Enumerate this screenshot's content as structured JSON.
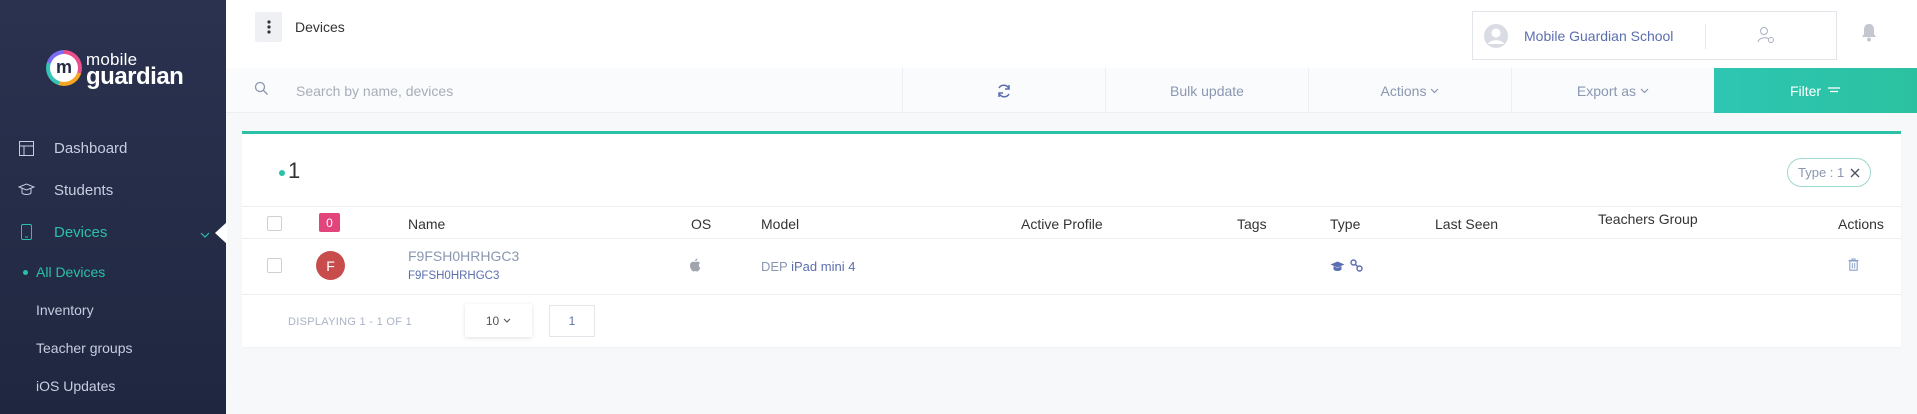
{
  "brand": {
    "line1": "mobile",
    "line2": "guardian"
  },
  "sidebar": {
    "items": [
      {
        "label": "Dashboard",
        "icon": "dashboard-icon"
      },
      {
        "label": "Students",
        "icon": "graduation-cap-icon"
      },
      {
        "label": "Devices",
        "icon": "phone-icon",
        "active": true
      }
    ],
    "subitems": [
      {
        "label": "All Devices",
        "active": true
      },
      {
        "label": "Inventory"
      },
      {
        "label": "Teacher groups"
      },
      {
        "label": "iOS Updates"
      }
    ]
  },
  "header": {
    "title": "Devices",
    "account_name": "Mobile Guardian School"
  },
  "toolbar": {
    "search_placeholder": "Search by name, devices",
    "bulk_update": "Bulk update",
    "actions": "Actions",
    "export": "Export as",
    "filter": "Filter"
  },
  "results": {
    "count": "1",
    "filter_chip": "Type : 1",
    "selected_badge": "0"
  },
  "table": {
    "columns": {
      "name": "Name",
      "os": "OS",
      "model": "Model",
      "active_profile": "Active Profile",
      "tags": "Tags",
      "type": "Type",
      "last_seen": "Last Seen",
      "teachers_group": "Teachers Group",
      "actions": "Actions"
    },
    "rows": [
      {
        "avatar_letter": "F",
        "name": "F9FSH0HRHGC3",
        "serial": "F9FSH0HRHGC3",
        "os": "apple-icon",
        "model_prefix": "DEP",
        "model_link": "iPad mini 4",
        "active_profile": "",
        "tags": "",
        "last_seen": "",
        "teachers_group": ""
      }
    ]
  },
  "pagination": {
    "display_text": "DISPLAYING 1 - 1 OF 1",
    "per_page": "10",
    "current_page": "1"
  },
  "colors": {
    "accent": "#2bc1a7",
    "sidebar_bg": "#232b45",
    "link": "#5b6fb0",
    "badge": "#e2457b",
    "avatar": "#c84c4c"
  }
}
